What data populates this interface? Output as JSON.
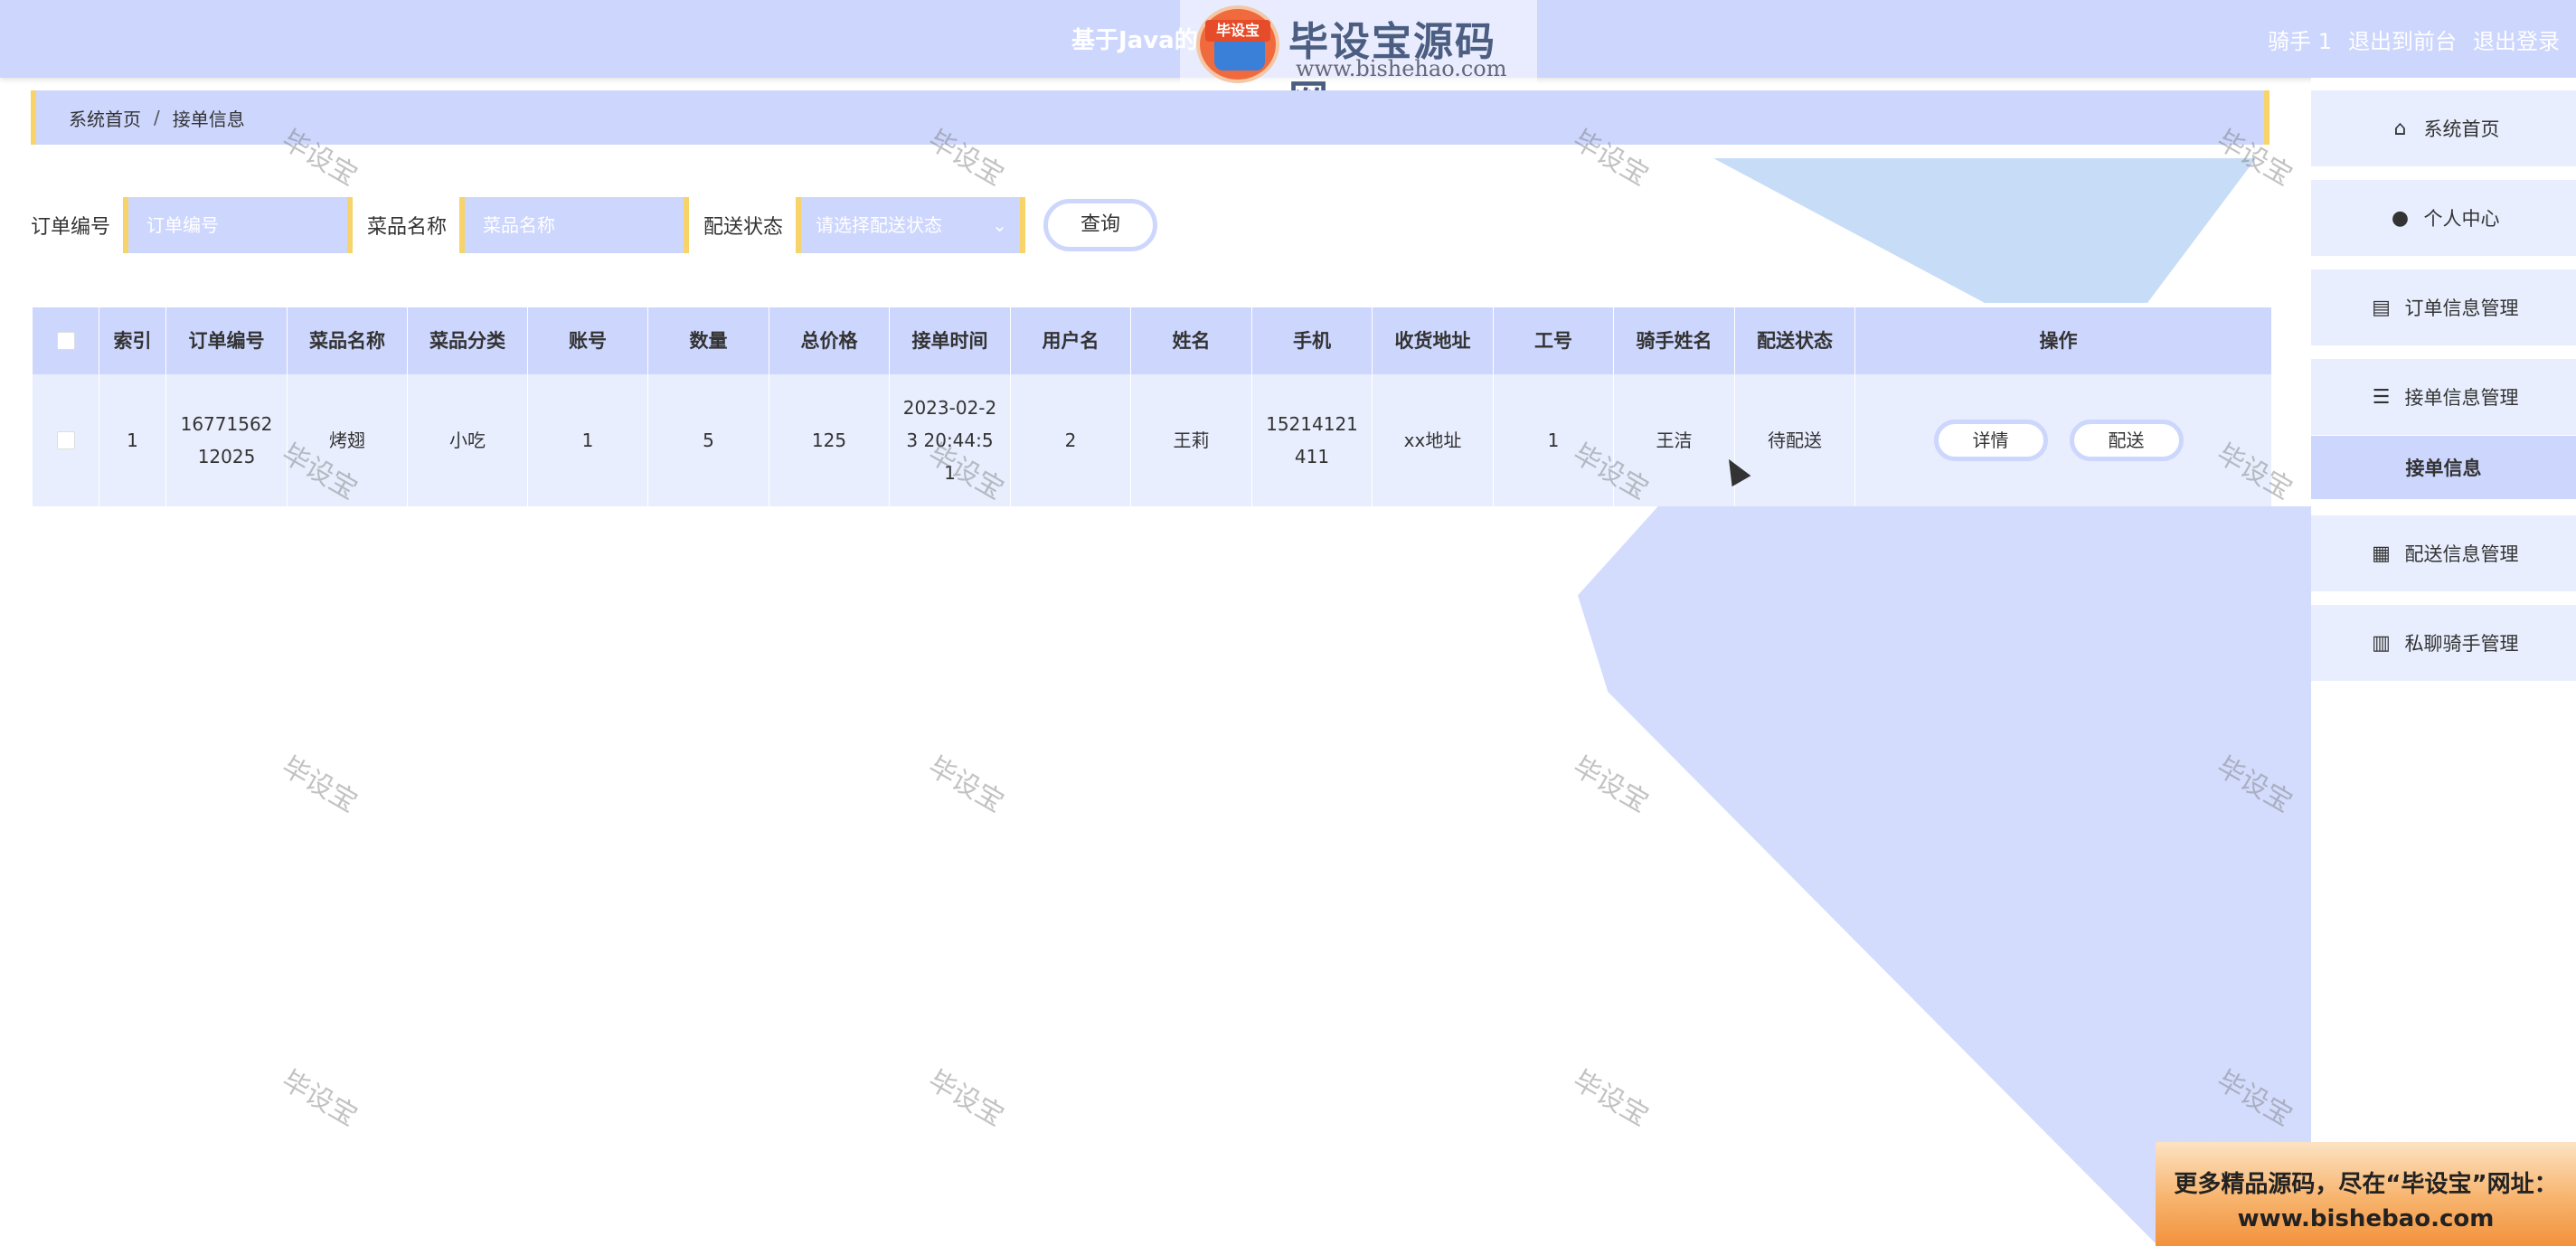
{
  "header": {
    "title": "基于Java的",
    "user": "骑手 1",
    "back_to_front": "退出到前台",
    "logout": "退出登录"
  },
  "logo": {
    "badge": "毕设宝",
    "name": "毕设宝源码网",
    "url": "www.bishehao.com"
  },
  "breadcrumb": {
    "home": "系统首页",
    "separator": "/",
    "current": "接单信息"
  },
  "search": {
    "order_no_label": "订单编号",
    "order_no_placeholder": "订单编号",
    "dish_label": "菜品名称",
    "dish_placeholder": "菜品名称",
    "status_label": "配送状态",
    "status_placeholder": "请选择配送状态",
    "query_button": "查询"
  },
  "table": {
    "headers": [
      "索引",
      "订单编号",
      "菜品名称",
      "菜品分类",
      "账号",
      "数量",
      "总价格",
      "接单时间",
      "用户名",
      "姓名",
      "手机",
      "收货地址",
      "工号",
      "骑手姓名",
      "配送状态",
      "操作"
    ],
    "rows": [
      {
        "index": "1",
        "order_no": "1677156212025",
        "dish": "烤翅",
        "category": "小吃",
        "account": "1",
        "quantity": "5",
        "total": "125",
        "time": "2023-02-23 20:44:51",
        "username": "2",
        "name": "王莉",
        "phone": "15214121411",
        "address": "xx地址",
        "worker_no": "1",
        "rider_name": "王洁",
        "status": "待配送",
        "detail_button": "详情",
        "deliver_button": "配送"
      }
    ]
  },
  "sidebar": {
    "items": [
      {
        "label": "系统首页",
        "icon": "home-icon"
      },
      {
        "label": "个人中心",
        "icon": "user-icon"
      },
      {
        "label": "订单信息管理",
        "icon": "clipboard-icon"
      },
      {
        "label": "接单信息管理",
        "icon": "list-icon"
      },
      {
        "label": "配送信息管理",
        "icon": "grid-icon"
      },
      {
        "label": "私聊骑手管理",
        "icon": "book-icon"
      }
    ],
    "sub_item": "接单信息"
  },
  "watermark": "毕设宝",
  "promo": {
    "line1": "更多精品源码，尽在“毕设宝”网址：",
    "line2": "www.bishebao.com"
  },
  "colors": {
    "accent": "#cdd6fd",
    "border_accent": "#f7d36a",
    "row_bg": "#e8eefe"
  }
}
